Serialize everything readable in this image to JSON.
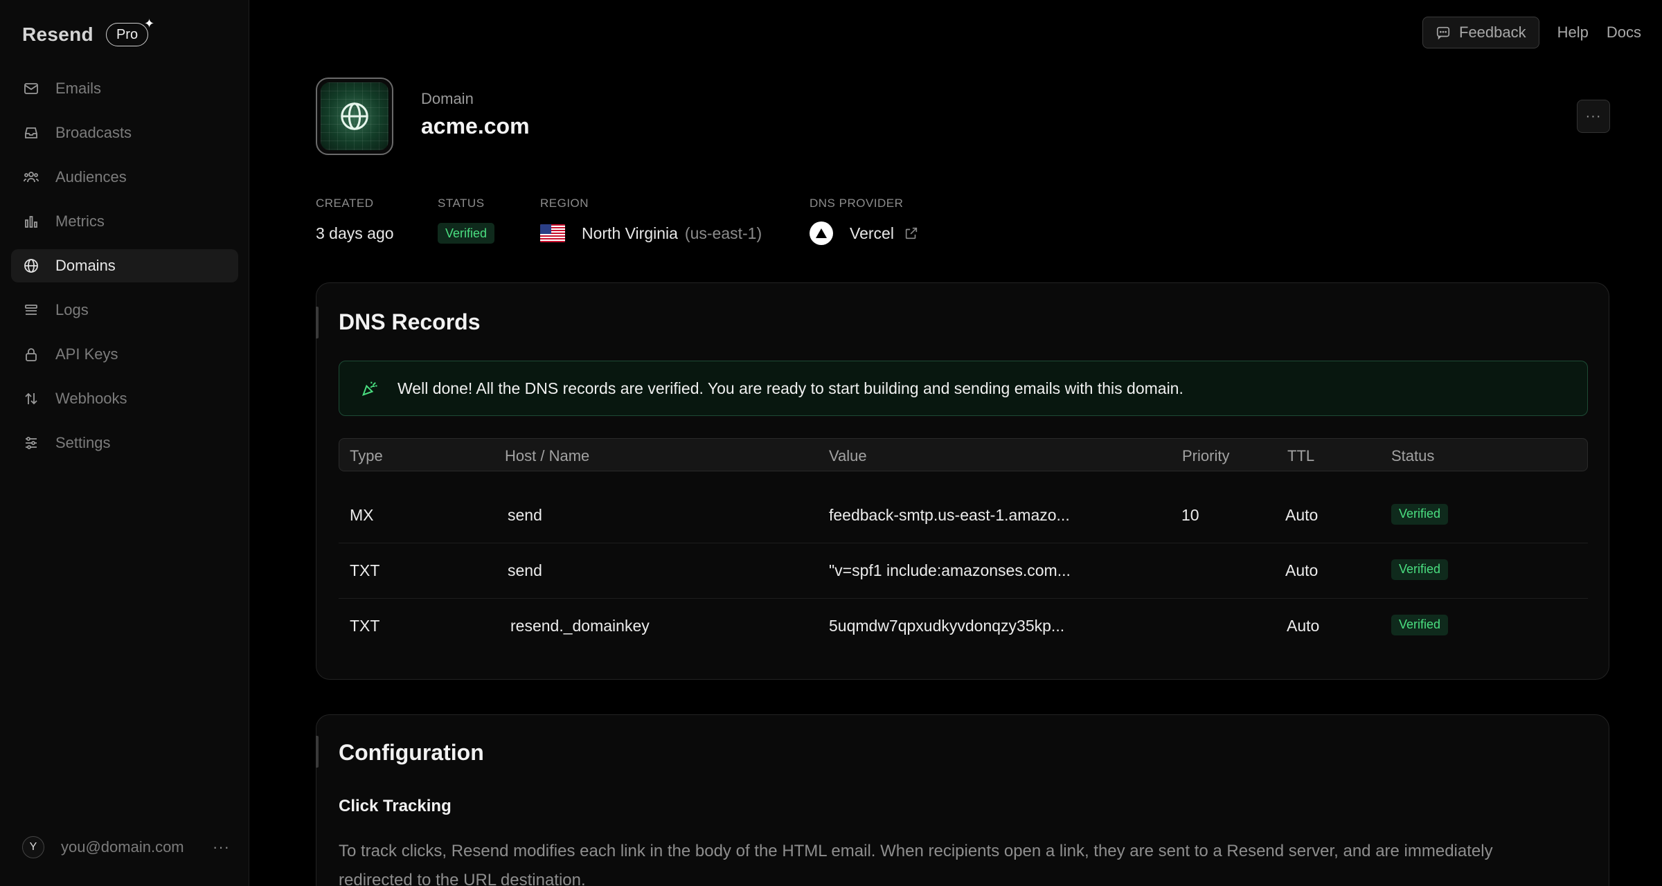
{
  "brand": {
    "name": "Resend",
    "plan": "Pro"
  },
  "nav": [
    {
      "label": "Emails",
      "icon": "mail-icon",
      "active": false
    },
    {
      "label": "Broadcasts",
      "icon": "inbox-icon",
      "active": false
    },
    {
      "label": "Audiences",
      "icon": "users-icon",
      "active": false
    },
    {
      "label": "Metrics",
      "icon": "bar-chart-icon",
      "active": false
    },
    {
      "label": "Domains",
      "icon": "globe-icon",
      "active": true
    },
    {
      "label": "Logs",
      "icon": "list-icon",
      "active": false
    },
    {
      "label": "API Keys",
      "icon": "lock-icon",
      "active": false
    },
    {
      "label": "Webhooks",
      "icon": "arrows-updown-icon",
      "active": false
    },
    {
      "label": "Settings",
      "icon": "sliders-icon",
      "active": false
    }
  ],
  "user": {
    "initial": "Y",
    "email": "you@domain.com",
    "more": "···"
  },
  "topbar": {
    "feedback": "Feedback",
    "help": "Help",
    "docs": "Docs"
  },
  "header": {
    "label": "Domain",
    "name": "acme.com",
    "more": "···"
  },
  "meta": {
    "created": {
      "label": "CREATED",
      "value": "3 days ago"
    },
    "status": {
      "label": "STATUS",
      "value": "Verified"
    },
    "region": {
      "label": "REGION",
      "name": "North Virginia",
      "code": "(us-east-1)"
    },
    "dns_provider": {
      "label": "DNS PROVIDER",
      "name": "Vercel"
    }
  },
  "dns": {
    "title": "DNS Records",
    "alert": "Well done! All the DNS records are verified. You are ready to start building and sending emails with this domain.",
    "columns": [
      "Type",
      "Host / Name",
      "Value",
      "Priority",
      "TTL",
      "Status"
    ],
    "rows": [
      {
        "type": "MX",
        "host": "send",
        "value": "feedback-smtp.us-east-1.amazo...",
        "priority": "10",
        "ttl": "Auto",
        "status": "Verified"
      },
      {
        "type": "TXT",
        "host": "send",
        "value": "\"v=spf1 include:amazonses.com...",
        "priority": "",
        "ttl": "Auto",
        "status": "Verified"
      },
      {
        "type": "TXT",
        "host": "resend._domainkey",
        "value": "5uqmdw7qpxudkyvdonqzy35kp...",
        "priority": "",
        "ttl": "Auto",
        "status": "Verified"
      }
    ]
  },
  "config": {
    "title": "Configuration",
    "subtitle": "Click Tracking",
    "text": "To track clicks, Resend modifies each link in the body of the HTML email. When recipients open a link, they are sent to a Resend server, and are immediately redirected to the URL destination."
  },
  "colors": {
    "accent_green": "#4ade80",
    "background": "#000000",
    "sidebar": "#0b0b0b"
  }
}
